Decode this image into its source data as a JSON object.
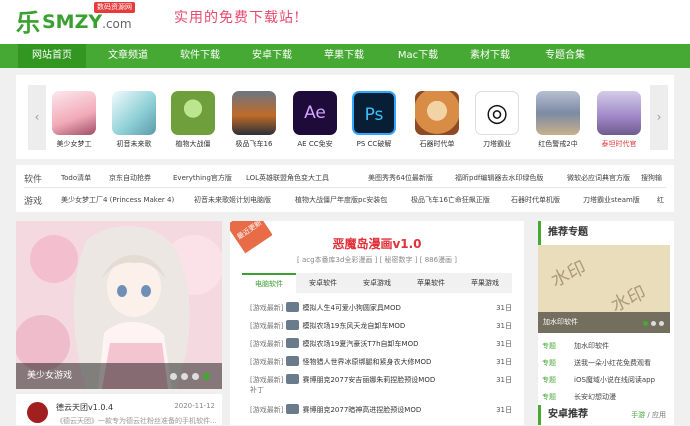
{
  "header": {
    "logo_mark": "乐",
    "logo_text": "SMZY",
    "logo_domain": ".com",
    "badge": "数码资源网",
    "slogan": "实用的免费下载站!"
  },
  "nav": [
    {
      "label": "网站首页",
      "active": true
    },
    {
      "label": "文章频道"
    },
    {
      "label": "软件下载"
    },
    {
      "label": "安卓下载"
    },
    {
      "label": "苹果下载"
    },
    {
      "label": "Mac下载"
    },
    {
      "label": "素材下载"
    },
    {
      "label": "专题合集"
    }
  ],
  "apps": [
    {
      "name": "美少女梦工",
      "icon": "anime-girl-icon",
      "color": "#f4b8c8"
    },
    {
      "name": "初音未来歌",
      "icon": "miku-icon",
      "color": "#a9d6de"
    },
    {
      "name": "植物大战僵",
      "icon": "zombie-icon",
      "color": "#6e9f3c"
    },
    {
      "name": "极品飞车16",
      "icon": "racing-car-icon",
      "color": "#4b5361"
    },
    {
      "name": "AE CC免安",
      "icon": "after-effects-icon",
      "color": "#1f0b3a"
    },
    {
      "name": "PS CC破解",
      "icon": "photoshop-icon",
      "color": "#071e34"
    },
    {
      "name": "石器时代单",
      "icon": "stone-age-icon",
      "color": "#d88c45"
    },
    {
      "name": "刀塔霸业",
      "icon": "steam-icon",
      "color": "#1b2838"
    },
    {
      "name": "红色警戒2中",
      "icon": "red-alert-icon",
      "color": "#7d8aa3"
    },
    {
      "name": "泰坦时代官",
      "icon": "titan-icon",
      "color": "#9e86c6",
      "highlight": true
    }
  ],
  "software": {
    "label": "软件",
    "items": [
      "Todo清单",
      "京东自动抢券",
      "Everything官方版",
      "LOL英雄联盟角色变大工具",
      "美图秀秀64位最新版",
      "福昕pdf编辑器去水印绿色版",
      "微软必应词典官方版",
      "搜狗输"
    ]
  },
  "games": {
    "label": "游戏",
    "items": [
      "美少女梦工厂4 (Princess Maker 4)",
      "初音未来歌姬计划电脑版",
      "植物大战僵尸年度版pc安装包",
      "极品飞车16亡命狂飙正版",
      "石器时代单机版",
      "刀塔霸业steam版",
      "红"
    ]
  },
  "banner": {
    "caption": "美少女游戏"
  },
  "bottom_left": {
    "title": "德云天团v1.0.4",
    "date": "2020-11-12",
    "desc": "《德云天团》一款专为德云社粉丝准备的手机软件..."
  },
  "news": {
    "ribbon": "最近更新",
    "title": "恶魔岛漫画v1.0",
    "subtitle": "[ acg本番库3d全彩漫画 ] [ 秘密数字 ] [ 886漫画 ]",
    "tabs": [
      "电脑软件",
      "安卓软件",
      "安卓游戏",
      "苹果软件",
      "苹果游戏"
    ],
    "rows": [
      {
        "cat": "[游戏最新]",
        "title": "模拟人生4可爱小狗圆家具MOD",
        "day": "31日"
      },
      {
        "cat": "[游戏最新]",
        "title": "模拟农场19东风天龙自卸车MOD",
        "day": "31日"
      },
      {
        "cat": "[游戏最新]",
        "title": "模拟农场19夏汽豪沃T7h自卸车MOD",
        "day": "31日"
      },
      {
        "cat": "[游戏最新]",
        "title": "怪物猎人世界冰原绑腿和紧身衣大修MOD",
        "day": "31日"
      },
      {
        "cat": "[游戏最新]",
        "title": "赛博朋克2077安吉丽娜朱莉捏脸预设MOD",
        "day": "31日"
      },
      {
        "cat": "补丁",
        "title": "",
        "day": ""
      },
      {
        "cat": "[游戏最新]",
        "title": "赛博朋克2077暗神高进捏脸预设MOD",
        "day": "31日"
      }
    ]
  },
  "topics": {
    "title": "推荐专题",
    "image_caption": "加水印软件",
    "watermark": "水印",
    "rows": [
      {
        "tag": "专题",
        "text": "加水印软件"
      },
      {
        "tag": "专题",
        "text": "送我一朵小红花免费观看"
      },
      {
        "tag": "专题",
        "text": "iOS魔域小说在线阅读app"
      },
      {
        "tag": "专题",
        "text": "长安幻想动漫"
      }
    ]
  },
  "android": {
    "title": "安卓推荐",
    "tabs": [
      "手游",
      "应用"
    ]
  }
}
